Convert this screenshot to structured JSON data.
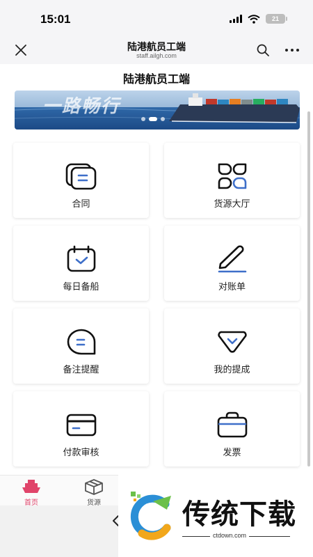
{
  "status": {
    "time": "15:01",
    "battery": "21"
  },
  "browser": {
    "title": "陆港航员工端",
    "url": "staff.ailgh.com"
  },
  "page": {
    "title": "陆港航员工端"
  },
  "banner": {
    "text": "一路畅行",
    "slides": 3,
    "active_slide": 1
  },
  "menu": [
    {
      "label": "合同",
      "icon": "contract-icon"
    },
    {
      "label": "货源大厅",
      "icon": "grid-apps-icon"
    },
    {
      "label": "每日备船",
      "icon": "calendar-check-icon"
    },
    {
      "label": "对账单",
      "icon": "pen-icon"
    },
    {
      "label": "备注提醒",
      "icon": "message-bubble-icon"
    },
    {
      "label": "我的提成",
      "icon": "diamond-icon"
    },
    {
      "label": "付款审核",
      "icon": "credit-card-icon"
    },
    {
      "label": "发票",
      "icon": "briefcase-icon"
    }
  ],
  "tabs": [
    {
      "label": "首页",
      "icon": "ship-icon",
      "active": true
    },
    {
      "label": "货源",
      "icon": "box-icon",
      "active": false
    }
  ],
  "watermark": {
    "name": "传统下载",
    "url": "ctdown.com"
  },
  "colors": {
    "accent": "#3e6fc9",
    "icon_dark": "#111111",
    "tab_active": "#e0446a"
  }
}
